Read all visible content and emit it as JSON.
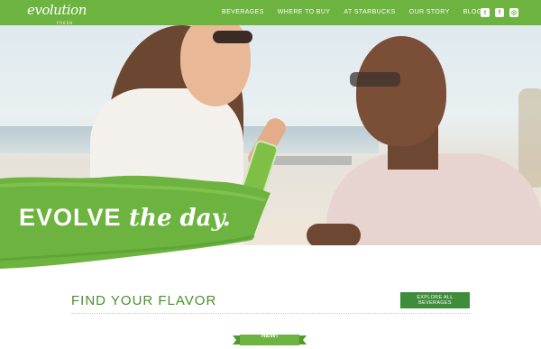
{
  "header": {
    "logo_text": "evolution",
    "logo_sub": "FRESH",
    "nav": [
      "BEVERAGES",
      "WHERE TO BUY",
      "AT STARBUCKS",
      "OUR STORY",
      "BLOG"
    ],
    "social": [
      {
        "icon": "twitter-icon",
        "glyph": "t"
      },
      {
        "icon": "facebook-icon",
        "glyph": "f"
      },
      {
        "icon": "instagram-icon",
        "glyph": "◎"
      }
    ]
  },
  "hero": {
    "tagline_main": "EVOLVE",
    "tagline_script": "the day."
  },
  "flavor": {
    "title": "FIND YOUR FLAVOR",
    "button": "EXPLORE ALL BEVERAGES",
    "badge": "NEW!"
  },
  "colors": {
    "brand_green": "#6cb33f",
    "button_green": "#3f8c3a",
    "title_green": "#4a8f2a"
  }
}
